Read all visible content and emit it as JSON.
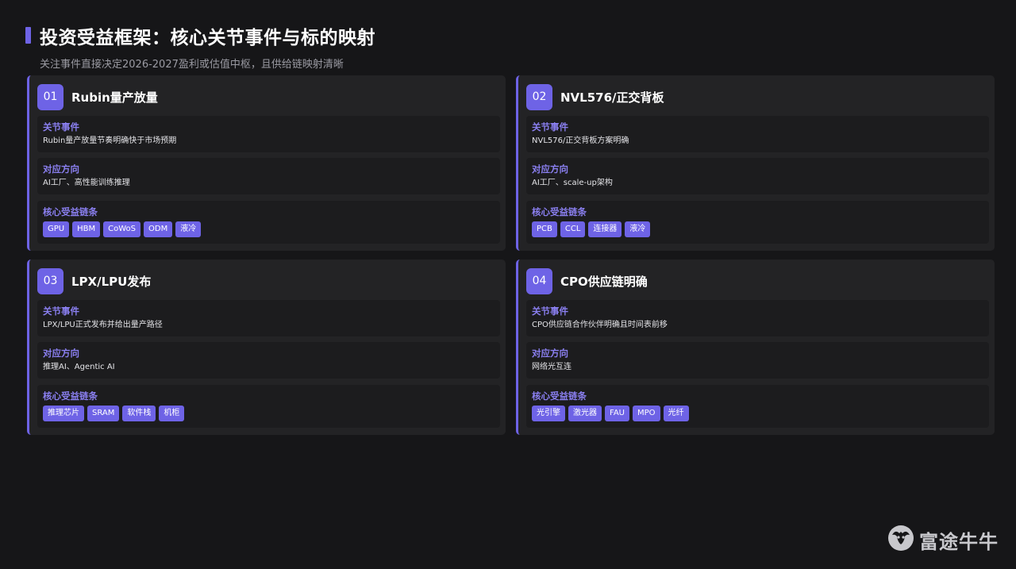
{
  "header": {
    "title": "投资受益框架：核心关节事件与标的映射",
    "subtitle": "关注事件直接决定2026-2027盈利或估值中枢，且供给链映射清晰"
  },
  "labels": {
    "event": "关节事件",
    "direction": "对应方向",
    "chain": "核心受益链条"
  },
  "cards": [
    {
      "num": "01",
      "title": "Rubin量产放量",
      "event": "Rubin量产放量节奏明确快于市场预期",
      "direction": "AI工厂、高性能训练推理",
      "tags": [
        "GPU",
        "HBM",
        "CoWoS",
        "ODM",
        "液冷"
      ]
    },
    {
      "num": "02",
      "title": "NVL576/正交背板",
      "event": "NVL576/正交背板方案明确",
      "direction": "AI工厂、scale-up架构",
      "tags": [
        "PCB",
        "CCL",
        "连接器",
        "液冷"
      ]
    },
    {
      "num": "03",
      "title": "LPX/LPU发布",
      "event": "LPX/LPU正式发布并给出量产路径",
      "direction": "推理AI、Agentic AI",
      "tags": [
        "推理芯片",
        "SRAM",
        "软件栈",
        "机柜"
      ]
    },
    {
      "num": "04",
      "title": "CPO供应链明确",
      "event": "CPO供应链合作伙伴明确且时间表前移",
      "direction": "网络光互连",
      "tags": [
        "光引擎",
        "激光器",
        "FAU",
        "MPO",
        "光纤"
      ]
    }
  ],
  "watermark": {
    "text": "富途牛牛",
    "icon": "futu-bull-logo-icon"
  },
  "colors": {
    "accent": "#6e63e6",
    "label": "#8a7ff0",
    "background": "#161618",
    "card": "#232325"
  }
}
